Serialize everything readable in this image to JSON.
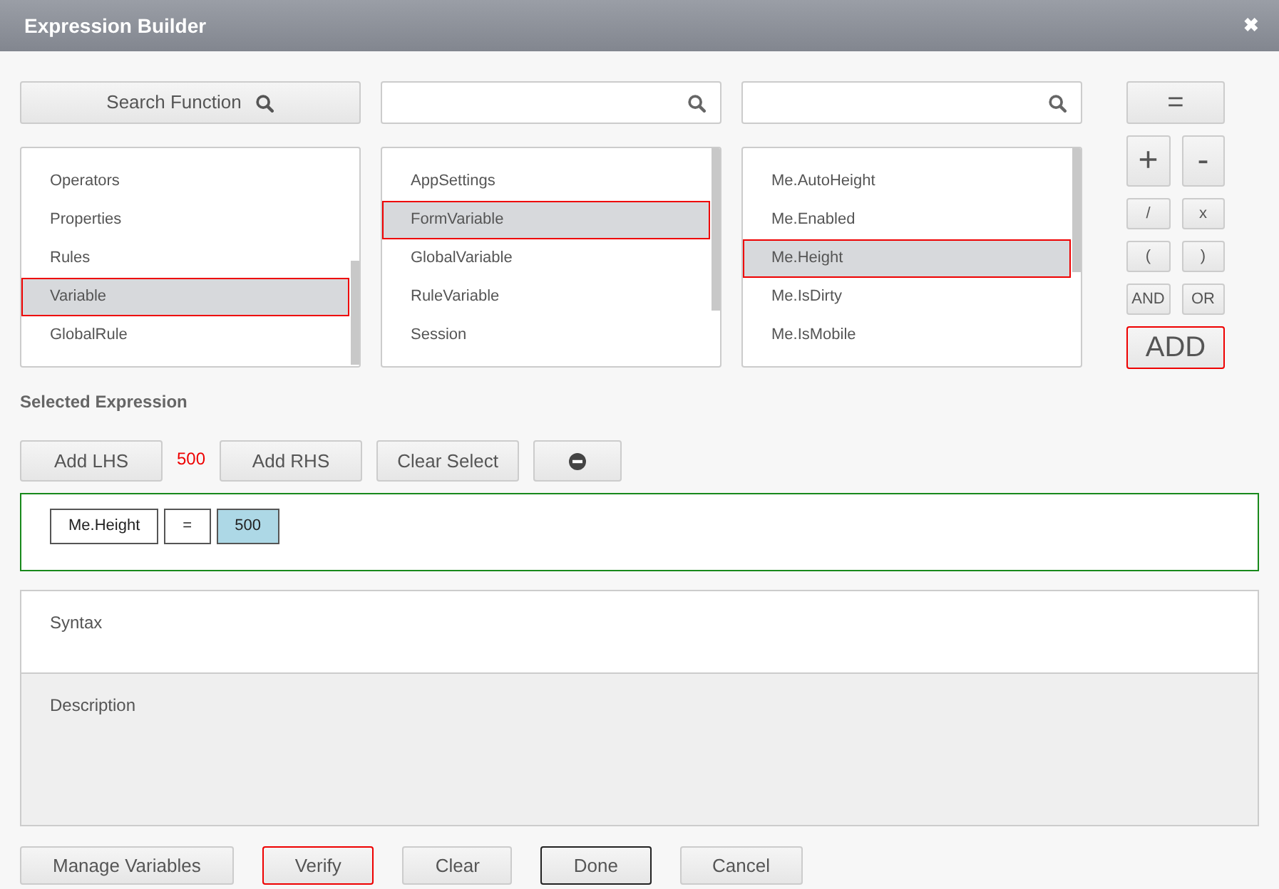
{
  "window": {
    "title": "Expression Builder",
    "close": "✖"
  },
  "search_function": {
    "label": "Search Function"
  },
  "search_fields": [
    {
      "kind": "search"
    },
    {
      "kind": "search"
    }
  ],
  "lists": [
    {
      "items": [
        {
          "label": "Operators",
          "selected": false
        },
        {
          "label": "Properties",
          "selected": false
        },
        {
          "label": "Rules",
          "selected": false
        },
        {
          "label": "Variable",
          "selected": true
        },
        {
          "label": "GlobalRule",
          "selected": false
        }
      ]
    },
    {
      "items": [
        {
          "label": "AppSettings",
          "selected": false
        },
        {
          "label": "FormVariable",
          "selected": true
        },
        {
          "label": "GlobalVariable",
          "selected": false
        },
        {
          "label": "RuleVariable",
          "selected": false
        },
        {
          "label": "Session",
          "selected": false
        }
      ]
    },
    {
      "items": [
        {
          "label": "Me.AutoHeight",
          "selected": false
        },
        {
          "label": "Me.Enabled",
          "selected": false
        },
        {
          "label": "Me.Height",
          "selected": true
        },
        {
          "label": "Me.IsDirty",
          "selected": false
        },
        {
          "label": "Me.IsMobile",
          "selected": false
        }
      ]
    }
  ],
  "operators": [
    {
      "label": "=",
      "kind": "full",
      "highlighted": false
    },
    {
      "label": "+",
      "kind": "big",
      "highlighted": false
    },
    {
      "label": "-",
      "kind": "big",
      "highlighted": false
    },
    {
      "label": "/",
      "kind": "small",
      "highlighted": false
    },
    {
      "label": "x",
      "kind": "small",
      "highlighted": false
    },
    {
      "label": "(",
      "kind": "small",
      "highlighted": false
    },
    {
      "label": ")",
      "kind": "small",
      "highlighted": false
    },
    {
      "label": "AND",
      "kind": "small",
      "highlighted": false
    },
    {
      "label": "OR",
      "kind": "small",
      "highlighted": false
    },
    {
      "label": "ADD",
      "kind": "full",
      "highlighted": true
    }
  ],
  "selected_expression": {
    "heading": "Selected Expression",
    "value": "500",
    "buttons": [
      {
        "label": "Add LHS",
        "kind": "text"
      },
      {
        "label": "Add RHS",
        "kind": "text"
      },
      {
        "label": "Clear Select",
        "kind": "text"
      },
      {
        "kind": "remove"
      }
    ],
    "tokens": [
      {
        "label": "Me.Height",
        "selected": false
      },
      {
        "label": "=",
        "selected": false
      },
      {
        "label": "500",
        "selected": true
      }
    ]
  },
  "syntax": {
    "label": "Syntax"
  },
  "description": {
    "label": "Description"
  },
  "footer_buttons": [
    {
      "label": "Manage Variables",
      "highlighted": false,
      "dark": false
    },
    {
      "label": "Verify",
      "highlighted": true,
      "dark": false
    },
    {
      "label": "Clear",
      "highlighted": false,
      "dark": false
    },
    {
      "label": "Done",
      "highlighted": false,
      "dark": true
    },
    {
      "label": "Cancel",
      "highlighted": false,
      "dark": false
    }
  ]
}
